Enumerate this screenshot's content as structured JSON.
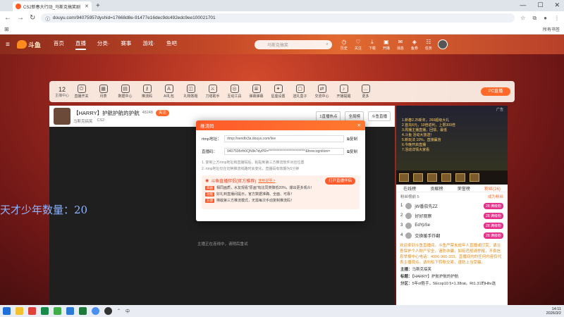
{
  "browser": {
    "tab_title": "CS2新春大行动_马斯克搞笑剧",
    "url": "douyu.com/94075957dyshid=17668d8e-91477e16dec9dc492edc9ee100021701",
    "all_bookmarks": "所有书签"
  },
  "site": {
    "logo_text": "斗鱼",
    "nav": [
      "首页",
      "直播",
      "分类·",
      "赛事",
      "游戏·",
      "鱼吧"
    ],
    "search_placeholder": "马斯克搞笑",
    "header_icons": [
      "历史",
      "关注",
      "下载",
      "开播",
      "消息",
      "鱼券",
      "任务"
    ]
  },
  "categories": {
    "count": "12",
    "count_label": "主播中心",
    "items": [
      "直播开关",
      "月表",
      "数据中心",
      "推流码",
      "AI礼包",
      "礼物答题",
      "刀塔助手",
      "互动工具",
      "弹幕弹幕",
      "星座设置",
      "送礼盒子",
      "交流中心",
      "开播提醒",
      "更多"
    ],
    "pc_button": "PC直播"
  },
  "stream": {
    "title": "【HARRY】护航护航的护航",
    "streamer": "马斯克搞笑",
    "follow": "关注",
    "heat": "48248",
    "category": "CS2",
    "right_btns": [
      "1直播热点",
      "全局榜",
      "斗鱼直播"
    ],
    "offline_msg": "主播正在连线中，请稍后重试"
  },
  "overlay_text": "天才少年数量：20",
  "panel": {
    "ad_tag": "广告",
    "ad_lines": [
      "1.新春2.25新年，260超级大礼",
      "2.首充6元，10倍返利，上限300倍",
      "3.周播主播直播，回馈、最低",
      "4.斗鱼 活动大放送！",
      "5.新玩法 10%，直接赢盲",
      "6.今晚开启直播",
      "7.活动详情大家看"
    ],
    "tabs": [
      "在线榜",
      "贡献榜",
      "荣誉榜",
      "粉丝(26)"
    ],
    "rank_title": "粉丝榜前 5",
    "rank_right": "成为粉丝",
    "ranks": [
      {
        "no": "1",
        "name": "jW番茄先ZZ",
        "level": "28 满级粉"
      },
      {
        "no": "2",
        "name": "好好观察",
        "level": "28 满级粉"
      },
      {
        "no": "3",
        "name": "EdYpSe",
        "level": "28 满级粉"
      },
      {
        "no": "4",
        "name": "交换暖手炸翻",
        "level": "28 满级粉"
      }
    ],
    "notice": "欢迎来到斗鱼直播间，斗鱼严禁未成年人直播或打赏，请注意保护个人财产安全，谨防诈骗，如有违规请举报，不良信息举报中心电话：4006-966-333。直播间内的任何内容仅代表主播观点。请勿私下转账交易，谨防上当受骗。",
    "chat": [
      {
        "user": "主播：",
        "text": "马斯克搞笑"
      },
      {
        "user": "标题：",
        "text": "【HARRY】护航护航的护航"
      },
      {
        "user": "分区：",
        "text": "5年of胜手，5Ecop10 5×1.38rat。Rt1.31的Hltv选"
      }
    ]
  },
  "modal": {
    "title": "推流码",
    "close": "✕",
    "rtmp_label": "rtmp地址：",
    "rtmp_value": "rtmp://sendtx3a.douyu.com/live",
    "key_label": "直播码：",
    "key_value": "9407595rfh0QN9k?dyPR=***************************&forecognition=",
    "copy": "复制",
    "tips": [
      "1. 复制上方rtmp地址和直播码后，粘贴到第三方推流软件对应位置",
      "2. rtmp地址仅在切换推流线路时会变化，直播码有效期为5分钟"
    ],
    "promo_title": "斗鱼直播伴侣(官方推荐)",
    "promo_sub": "使用说明 >",
    "open_button": "打开直播伴侣",
    "promo_rows": [
      {
        "badge": "高画",
        "text": "相同画质，水友观看\"原画\"有比同类降低20%，爆出更多观众！"
      },
      {
        "badge": "功能",
        "text": "好礼到直播间提示，官方数据准确、全面、可靠！"
      },
      {
        "badge": "方便",
        "text": "擦敌第三方推流模式，无需每次手动复制推流码！"
      }
    ]
  },
  "taskbar": {
    "time": "14:11",
    "date": "2026/3/2",
    "lang": "中"
  },
  "colors": {
    "brand_orange": "#ff6a2b",
    "header_red": "#c74a28"
  }
}
